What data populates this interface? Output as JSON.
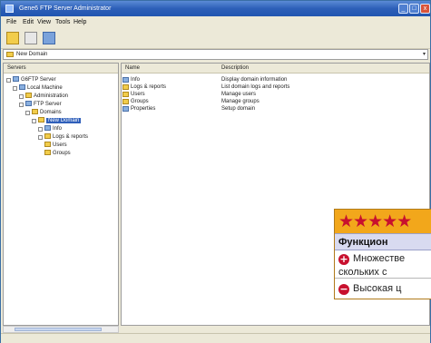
{
  "window": {
    "title": "Gene6 FTP Server Administrator"
  },
  "menu": {
    "items": [
      "File",
      "Edit",
      "View",
      "Tools",
      "Help"
    ]
  },
  "address": {
    "value": "New Domain"
  },
  "tree": {
    "header": "Servers",
    "nodes": [
      {
        "label": "G6FTP Server"
      },
      {
        "label": "Local Machine"
      },
      {
        "label": "Administration"
      },
      {
        "label": "FTP Server"
      },
      {
        "label": "Domains"
      },
      {
        "label": "New Domain"
      },
      {
        "label": "Info"
      },
      {
        "label": "Logs & reports"
      },
      {
        "label": "Users"
      },
      {
        "label": "Groups"
      }
    ]
  },
  "list": {
    "columns": [
      "Name",
      "Description"
    ],
    "rows": [
      {
        "name": "Info",
        "desc": "Display domain information"
      },
      {
        "name": "Logs & reports",
        "desc": "List domain logs and reports"
      },
      {
        "name": "Users",
        "desc": "Manage users"
      },
      {
        "name": "Groups",
        "desc": "Manage groups"
      },
      {
        "name": "Properties",
        "desc": "Setup domain"
      }
    ]
  },
  "rating": {
    "stars": "★★★★★",
    "title": "Функцион",
    "pro_line1": "Множестве",
    "pro_line2": "скольких с",
    "con_line1": "Высокая ц",
    "colors": {
      "stars_bg": "#f2a71b",
      "star": "#c8102e",
      "title_bg": "#d8daf0"
    }
  }
}
